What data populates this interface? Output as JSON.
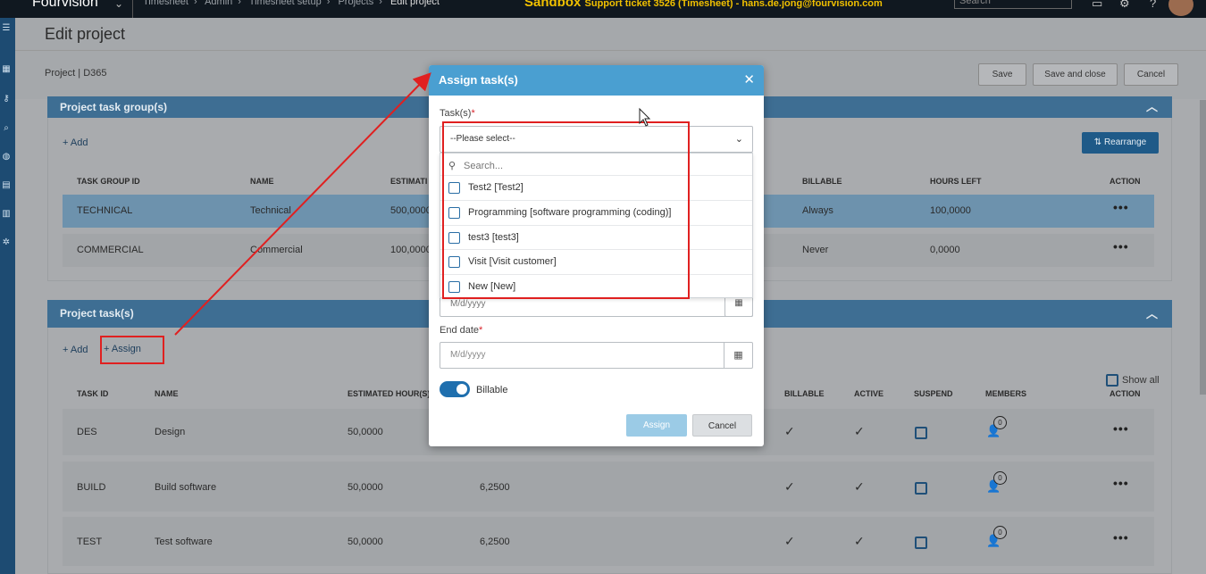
{
  "topbar": {
    "logo": "Fourvision",
    "breadcrumbs": [
      "Timesheet",
      "Admin",
      "Timesheet setup",
      "Projects",
      "Edit project"
    ],
    "sandbox_label": "Sandbox",
    "sandbox_note": "Support ticket 3526 (Timesheet) - hans.de.jong@fourvision.com",
    "search_placeholder": "Search"
  },
  "page": {
    "title": "Edit project",
    "project_ref": "Project | D365",
    "buttons": {
      "save": "Save",
      "save_close": "Save and close",
      "cancel": "Cancel"
    }
  },
  "task_groups": {
    "title": "Project task group(s)",
    "add_label": "+ Add",
    "rearrange_label": "Rearrange",
    "columns": [
      "TASK GROUP ID",
      "NAME",
      "ESTIMATI",
      "BILLABLE",
      "HOURS LEFT",
      "ACTION"
    ],
    "rows": [
      {
        "id": "TECHNICAL",
        "name": "Technical",
        "est": "500,0000",
        "billable": "Always",
        "hours_left": "100,0000",
        "action": "•••"
      },
      {
        "id": "COMMERCIAL",
        "name": "Commercial",
        "est": "100,0000",
        "billable": "Never",
        "hours_left": "0,0000",
        "action": "•••"
      }
    ]
  },
  "project_tasks": {
    "title": "Project task(s)",
    "add_label": "+ Add",
    "assign_label": "+ Assign",
    "show_all_label": "Show all",
    "columns": [
      "TASK ID",
      "NAME",
      "ESTIMATED HOUR(S)",
      "BILLABLE",
      "ACTIVE",
      "SUSPEND",
      "MEMBERS",
      "ACTION"
    ],
    "rows": [
      {
        "id": "DES",
        "name": "Design",
        "est": "50,0000",
        "left": "",
        "billable": "✓",
        "active": "✓",
        "members": "0",
        "action": "•••"
      },
      {
        "id": "BUILD",
        "name": "Build software",
        "est": "50,0000",
        "left": "6,2500",
        "billable": "✓",
        "active": "✓",
        "members": "0",
        "action": "•••"
      },
      {
        "id": "TEST",
        "name": "Test software",
        "est": "50,0000",
        "left": "6,2500",
        "billable": "✓",
        "active": "✓",
        "members": "0",
        "action": "•••"
      }
    ]
  },
  "modal": {
    "title": "Assign task(s)",
    "tasks_label": "Task(s)",
    "select_placeholder": "--Please select--",
    "search_placeholder": "Search...",
    "options": [
      "Test2 [Test2]",
      "Programming [software programming (coding)]",
      "test3 [test3]",
      "Visit [Visit customer]",
      "New [New]"
    ],
    "start_date_placeholder": "M/d/yyyy",
    "end_date_label": "End date",
    "end_date_placeholder": "M/d/yyyy",
    "billable_label": "Billable",
    "billable_on": true,
    "assign_button": "Assign",
    "cancel_button": "Cancel"
  },
  "colors": {
    "accent": "#4a9fd1",
    "annotation": "#e02020",
    "sandbox": "#f0c000"
  }
}
